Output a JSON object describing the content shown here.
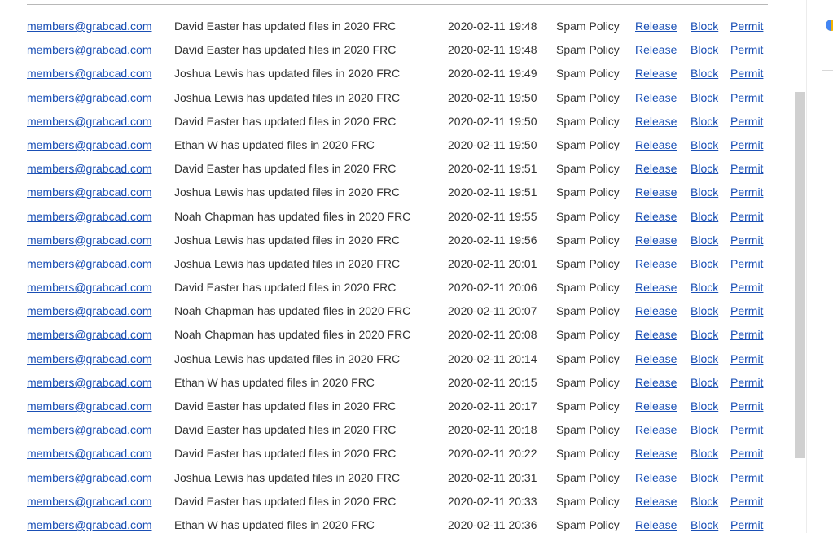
{
  "quarantine": {
    "policy_label": "Spam Policy",
    "actions": {
      "release": "Release",
      "block": "Block",
      "permit": "Permit"
    },
    "rows": [
      {
        "sender": "members@grabcad.com",
        "subject": "David Easter has updated files in 2020 FRC",
        "date": "2020-02-11 19:48"
      },
      {
        "sender": "members@grabcad.com",
        "subject": "David Easter has updated files in 2020 FRC",
        "date": "2020-02-11 19:48"
      },
      {
        "sender": "members@grabcad.com",
        "subject": "Joshua Lewis has updated files in 2020 FRC",
        "date": "2020-02-11 19:49"
      },
      {
        "sender": "members@grabcad.com",
        "subject": "Joshua Lewis has updated files in 2020 FRC",
        "date": "2020-02-11 19:50"
      },
      {
        "sender": "members@grabcad.com",
        "subject": "David Easter has updated files in 2020 FRC",
        "date": "2020-02-11 19:50"
      },
      {
        "sender": "members@grabcad.com",
        "subject": "Ethan W has updated files in 2020 FRC",
        "date": "2020-02-11 19:50"
      },
      {
        "sender": "members@grabcad.com",
        "subject": "David Easter has updated files in 2020 FRC",
        "date": "2020-02-11 19:51"
      },
      {
        "sender": "members@grabcad.com",
        "subject": "Joshua Lewis has updated files in 2020 FRC",
        "date": "2020-02-11 19:51"
      },
      {
        "sender": "members@grabcad.com",
        "subject": "Noah Chapman has updated files in 2020 FRC",
        "date": "2020-02-11 19:55"
      },
      {
        "sender": "members@grabcad.com",
        "subject": "Joshua Lewis has updated files in 2020 FRC",
        "date": "2020-02-11 19:56"
      },
      {
        "sender": "members@grabcad.com",
        "subject": "Joshua Lewis has updated files in 2020 FRC",
        "date": "2020-02-11 20:01"
      },
      {
        "sender": "members@grabcad.com",
        "subject": "David Easter has updated files in 2020 FRC",
        "date": "2020-02-11 20:06"
      },
      {
        "sender": "members@grabcad.com",
        "subject": "Noah Chapman has updated files in 2020 FRC",
        "date": "2020-02-11 20:07"
      },
      {
        "sender": "members@grabcad.com",
        "subject": "Noah Chapman has updated files in 2020 FRC",
        "date": "2020-02-11 20:08"
      },
      {
        "sender": "members@grabcad.com",
        "subject": "Joshua Lewis has updated files in 2020 FRC",
        "date": "2020-02-11 20:14"
      },
      {
        "sender": "members@grabcad.com",
        "subject": "Ethan W has updated files in 2020 FRC",
        "date": "2020-02-11 20:15"
      },
      {
        "sender": "members@grabcad.com",
        "subject": "David Easter has updated files in 2020 FRC",
        "date": "2020-02-11 20:17"
      },
      {
        "sender": "members@grabcad.com",
        "subject": "David Easter has updated files in 2020 FRC",
        "date": "2020-02-11 20:18"
      },
      {
        "sender": "members@grabcad.com",
        "subject": "David Easter has updated files in 2020 FRC",
        "date": "2020-02-11 20:22"
      },
      {
        "sender": "members@grabcad.com",
        "subject": "Joshua Lewis has updated files in 2020 FRC",
        "date": "2020-02-11 20:31"
      },
      {
        "sender": "members@grabcad.com",
        "subject": "David Easter has updated files in 2020 FRC",
        "date": "2020-02-11 20:33"
      },
      {
        "sender": "members@grabcad.com",
        "subject": "Ethan W has updated files in 2020 FRC",
        "date": "2020-02-11 20:36"
      }
    ]
  },
  "side_panel": {
    "icon": "google-apps-icon"
  },
  "colors": {
    "link": "#1a4fb5",
    "text": "#333333",
    "scrollbar_thumb": "#d0d0d0"
  }
}
